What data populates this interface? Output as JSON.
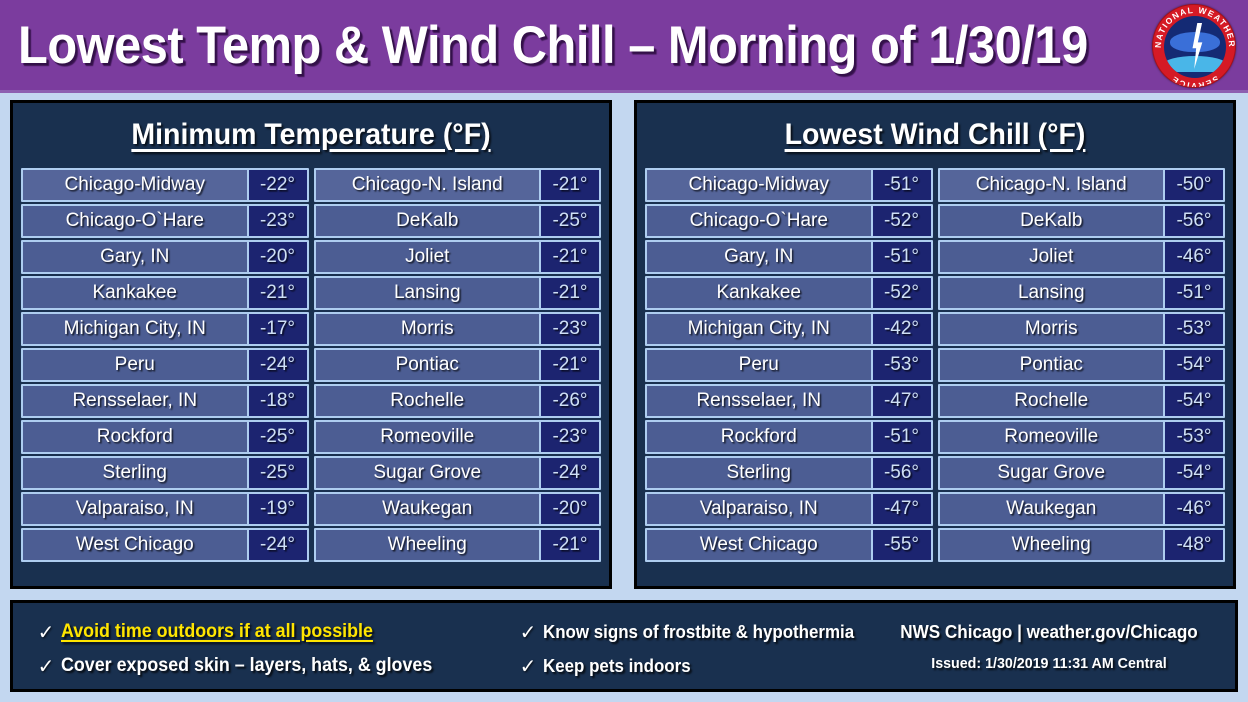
{
  "header": {
    "title": "Lowest Temp & Wind Chill – Morning of 1/30/19",
    "accent_color": "#7b3c9e",
    "logo": {
      "name": "nws-logo",
      "ring_text_top": "NATIONAL WEATHER",
      "ring_text_bottom": "SERVICE",
      "ring_color": "#d51a25",
      "interior_color": "#142a74"
    }
  },
  "panels": [
    {
      "id": "minimum-temperature",
      "title": "Minimum Temperature (°F)",
      "column_left": [
        {
          "site": "Chicago-Midway",
          "value": "-22°"
        },
        {
          "site": "Chicago-O`Hare",
          "value": "-23°"
        },
        {
          "site": "Gary, IN",
          "value": "-20°"
        },
        {
          "site": "Kankakee",
          "value": "-21°"
        },
        {
          "site": "Michigan City, IN",
          "value": "-17°"
        },
        {
          "site": "Peru",
          "value": "-24°"
        },
        {
          "site": "Rensselaer, IN",
          "value": "-18°"
        },
        {
          "site": "Rockford",
          "value": "-25°"
        },
        {
          "site": "Sterling",
          "value": "-25°"
        },
        {
          "site": "Valparaiso, IN",
          "value": "-19°"
        },
        {
          "site": "West Chicago",
          "value": "-24°"
        }
      ],
      "column_right": [
        {
          "site": "Chicago-N. Island",
          "value": "-21°"
        },
        {
          "site": "DeKalb",
          "value": "-25°"
        },
        {
          "site": "Joliet",
          "value": "-21°"
        },
        {
          "site": "Lansing",
          "value": "-21°"
        },
        {
          "site": "Morris",
          "value": "-23°"
        },
        {
          "site": "Pontiac",
          "value": "-21°"
        },
        {
          "site": "Rochelle",
          "value": "-26°"
        },
        {
          "site": "Romeoville",
          "value": "-23°"
        },
        {
          "site": "Sugar Grove",
          "value": "-24°"
        },
        {
          "site": "Waukegan",
          "value": "-20°"
        },
        {
          "site": "Wheeling",
          "value": "-21°"
        }
      ]
    },
    {
      "id": "lowest-wind-chill",
      "title": "Lowest Wind Chill (°F)",
      "column_left": [
        {
          "site": "Chicago-Midway",
          "value": "-51°"
        },
        {
          "site": "Chicago-O`Hare",
          "value": "-52°"
        },
        {
          "site": "Gary, IN",
          "value": "-51°"
        },
        {
          "site": "Kankakee",
          "value": "-52°"
        },
        {
          "site": "Michigan City, IN",
          "value": "-42°"
        },
        {
          "site": "Peru",
          "value": "-53°"
        },
        {
          "site": "Rensselaer, IN",
          "value": "-47°"
        },
        {
          "site": "Rockford",
          "value": "-51°"
        },
        {
          "site": "Sterling",
          "value": "-56°"
        },
        {
          "site": "Valparaiso, IN",
          "value": "-47°"
        },
        {
          "site": "West Chicago",
          "value": "-55°"
        }
      ],
      "column_right": [
        {
          "site": "Chicago-N. Island",
          "value": "-50°"
        },
        {
          "site": "DeKalb",
          "value": "-56°"
        },
        {
          "site": "Joliet",
          "value": "-46°"
        },
        {
          "site": "Lansing",
          "value": "-51°"
        },
        {
          "site": "Morris",
          "value": "-53°"
        },
        {
          "site": "Pontiac",
          "value": "-54°"
        },
        {
          "site": "Rochelle",
          "value": "-54°"
        },
        {
          "site": "Romeoville",
          "value": "-53°"
        },
        {
          "site": "Sugar Grove",
          "value": "-54°"
        },
        {
          "site": "Waukegan",
          "value": "-46°"
        },
        {
          "site": "Wheeling",
          "value": "-48°"
        }
      ]
    }
  ],
  "footer": {
    "check_glyph": "✓",
    "tips_column_1": [
      {
        "text": "Avoid time outdoors if at all possible",
        "highlight": true
      },
      {
        "text": "Cover exposed skin – layers, hats, & gloves",
        "highlight": false
      }
    ],
    "tips_column_2": [
      {
        "text": "Know signs of frostbite  & hypothermia",
        "highlight": false
      },
      {
        "text": "Keep pets indoors",
        "highlight": false
      }
    ],
    "credit": "NWS Chicago  |  weather.gov/Chicago",
    "issued": "Issued:  1/30/2019 11:31 AM Central",
    "highlight_color": "#ffe500"
  }
}
